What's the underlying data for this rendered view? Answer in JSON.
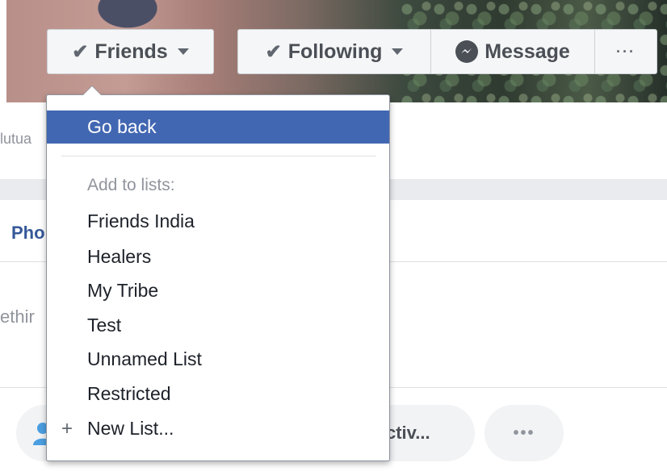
{
  "profile_actions": {
    "friends_label": "Friends",
    "following_label": "Following",
    "message_label": "Message",
    "more_label": "···"
  },
  "background": {
    "mutual_fragment": "lutua",
    "tab_fragment": "Pho",
    "composer_fragment": "ethir",
    "activity_fragment": "ctiv...",
    "more_dots": "•••"
  },
  "friends_menu": {
    "go_back": "Go back",
    "lists_heading": "Add to lists:",
    "lists": [
      "Friends India",
      "Healers",
      "My Tribe",
      "Test",
      "Unnamed List",
      "Restricted"
    ],
    "new_list": "New List...",
    "new_list_icon": "+"
  },
  "colors": {
    "highlight": "#4267b2",
    "link": "#365899",
    "button_bg": "#f5f6f7"
  }
}
